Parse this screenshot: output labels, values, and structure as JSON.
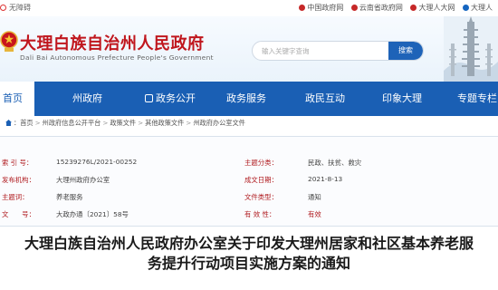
{
  "topbar": {
    "accessibility": "无障碍",
    "links": [
      "中国政府网",
      "云南省政府网",
      "大理人大网",
      "大理人"
    ]
  },
  "header": {
    "title_cn": "大理白族自治州人民政府",
    "title_en": "Dali Bai Autonomous Prefecture People's Government",
    "search_placeholder": "输入关键字查询",
    "search_button": "搜索"
  },
  "nav": {
    "items": [
      "首页",
      "州政府",
      "政务公开",
      "政务服务",
      "政民互动",
      "印象大理",
      "专题专栏"
    ],
    "active_index": 0
  },
  "breadcrumb": [
    "首页",
    "州政府信息公开平台",
    "政策文件",
    "其他政策文件",
    "州政府办公室文件"
  ],
  "info": {
    "row1": {
      "label": "索 引 号：",
      "value": "15239276L/2021-00252",
      "label2": "主题分类：",
      "value2": "民政、扶贫、救灾"
    },
    "row2": {
      "label": "发布机构：",
      "value": "大理州政府办公室",
      "label2": "成文日期：",
      "value2": "2021-8-13"
    },
    "row3": {
      "label": "主题词：",
      "value": "养老服务",
      "label2": "文件类型：",
      "value2": "通知"
    },
    "row4": {
      "label": "文　　号：",
      "value": "大政办通〔2021〕58号",
      "label2": "有 效 性：",
      "value2": "有效"
    }
  },
  "article": {
    "title_line1": "大理白族自治州人民政府办公室关于印发大理州居家和社区基本养老服",
    "title_line2": "务提升行动项目实施方案的通知"
  },
  "colors": {
    "brand_red": "#c0161d",
    "nav_blue": "#1a5fb4"
  }
}
